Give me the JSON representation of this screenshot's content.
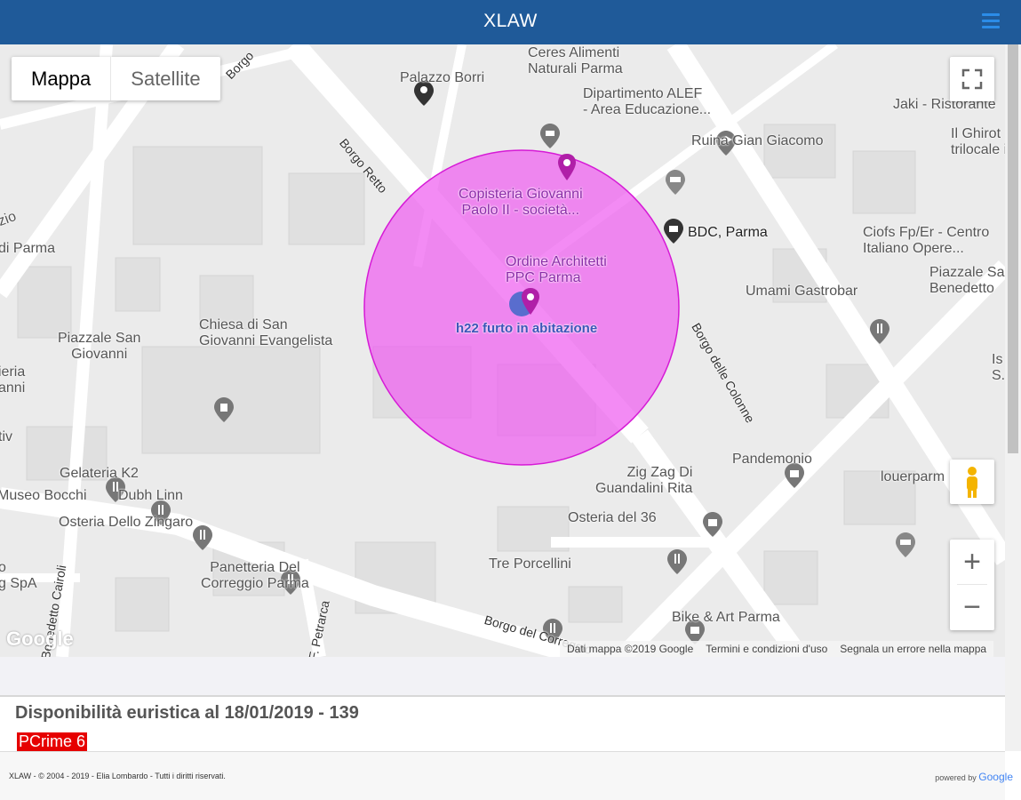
{
  "app": {
    "title": "XLAW"
  },
  "map": {
    "type_controls": {
      "map": "Mappa",
      "satellite": "Satellite"
    },
    "places": [
      {
        "name": "Palazzo Borri"
      },
      {
        "name": "Ceres Alimenti\nNaturali Parma"
      },
      {
        "name": "Dipartimento ALEF\n- Area Educazione..."
      },
      {
        "name": "Ruina Gian Giacomo"
      },
      {
        "name": "Jaki - Ristorante"
      },
      {
        "name": "Il Ghirot\ntrilocale in c"
      },
      {
        "name": "Copisteria Giovanni\nPaolo II - società..."
      },
      {
        "name": "BDC, Parma"
      },
      {
        "name": "Ciofs Fp/Er - Centro\nItaliano Opere..."
      },
      {
        "name": "Piazzale Sa\nBenedetto"
      },
      {
        "name": "Ordine Architetti\nPPC Parma"
      },
      {
        "name": "Umami Gastrobar"
      },
      {
        "name": "Chiesa di San\nGiovanni Evangelista"
      },
      {
        "name": "Piazzale San\nGiovanni"
      },
      {
        "name": "Pandemonio"
      },
      {
        "name": "Zig Zag Di\nGuandalini Rita"
      },
      {
        "name": "louerparm"
      },
      {
        "name": "Gelateria K2"
      },
      {
        "name": "Dubh Linn"
      },
      {
        "name": "Museo Bocchi"
      },
      {
        "name": "Osteria Dello Zingaro"
      },
      {
        "name": "Osteria del 36"
      },
      {
        "name": "Panetteria Del\nCorreggio Parma"
      },
      {
        "name": "Tre Porcellini"
      },
      {
        "name": "Bike & Art Parma"
      },
      {
        "name": "di Parma"
      },
      {
        "name": "zio"
      },
      {
        "name": "ieria\nanni"
      },
      {
        "name": "tiv"
      },
      {
        "name": "o\ng SpA"
      },
      {
        "name": "Is\nS."
      }
    ],
    "roads": {
      "borgo_retto": "Borgo Retto",
      "borgo_colonne": "Borgo delle Colonne",
      "borgo_correggio": "Borgo del Correggio",
      "benedetto_cairoli": "Benedetto Cairoli",
      "petrarca": "F. Petrarca",
      "borgo": "Borgo"
    },
    "incident": {
      "label": "h22 furto in abitazione"
    },
    "attribution": [
      "Dati mappa ©2019 Google",
      "Termini e condizioni d'uso",
      "Segnala un errore nella mappa"
    ],
    "google_logo": "Google",
    "colors": {
      "circle_fill": "#ee5ef0",
      "circle_stroke": "#d61ad6",
      "header": "#1f5a99"
    }
  },
  "info": {
    "availability": "Disponibilità euristica al 18/01/2019 - 139",
    "pcrime": "PCrime 6"
  },
  "footer": {
    "copyright": "XLAW - © 2004 - 2019 - Elia Lombardo - Tutti i diritti riservati.",
    "powered_prefix": "powered by",
    "powered_brand": "Google"
  }
}
